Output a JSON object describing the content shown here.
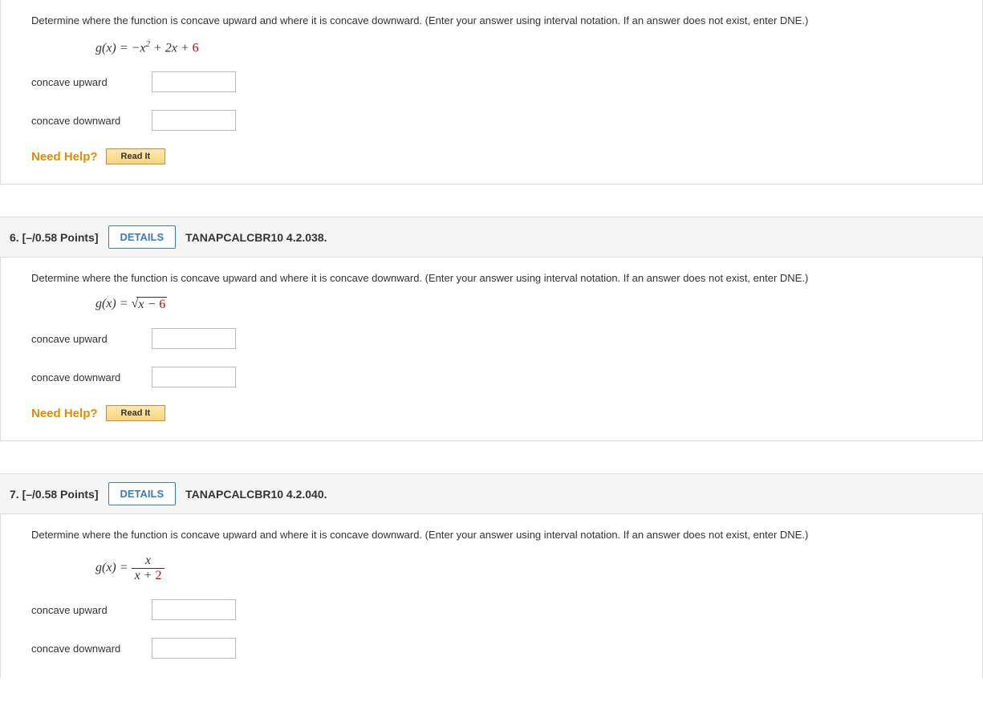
{
  "q5": {
    "prompt": "Determine where the function is concave upward and where it is concave downward. (Enter your answer using interval notation. If an answer does not exist, enter DNE.)",
    "formula_prefix": "g(x) = −x",
    "formula_exp": "2",
    "formula_suffix": " + 2x + ",
    "formula_const": "6",
    "label_up": "concave upward",
    "label_down": "concave downward",
    "need_help": "Need Help?",
    "read_it": "Read It"
  },
  "q6": {
    "number": "6.",
    "points": "[–/0.58 Points]",
    "details": "DETAILS",
    "source": "TANAPCALCBR10 4.2.038.",
    "prompt": "Determine where the function is concave upward and where it is concave downward. (Enter your answer using interval notation. If an answer does not exist, enter DNE.)",
    "formula_prefix": "g(x) = ",
    "sqrt_body": "x − ",
    "sqrt_const": "6",
    "label_up": "concave upward",
    "label_down": "concave downward",
    "need_help": "Need Help?",
    "read_it": "Read It"
  },
  "q7": {
    "number": "7.",
    "points": "[–/0.58 Points]",
    "details": "DETAILS",
    "source": "TANAPCALCBR10 4.2.040.",
    "prompt": "Determine where the function is concave upward and where it is concave downward. (Enter your answer using interval notation. If an answer does not exist, enter DNE.)",
    "formula_prefix": "g(x) = ",
    "frac_num": "x",
    "frac_den_pre": "x + ",
    "frac_den_const": "2",
    "label_up": "concave upward",
    "label_down": "concave downward"
  }
}
